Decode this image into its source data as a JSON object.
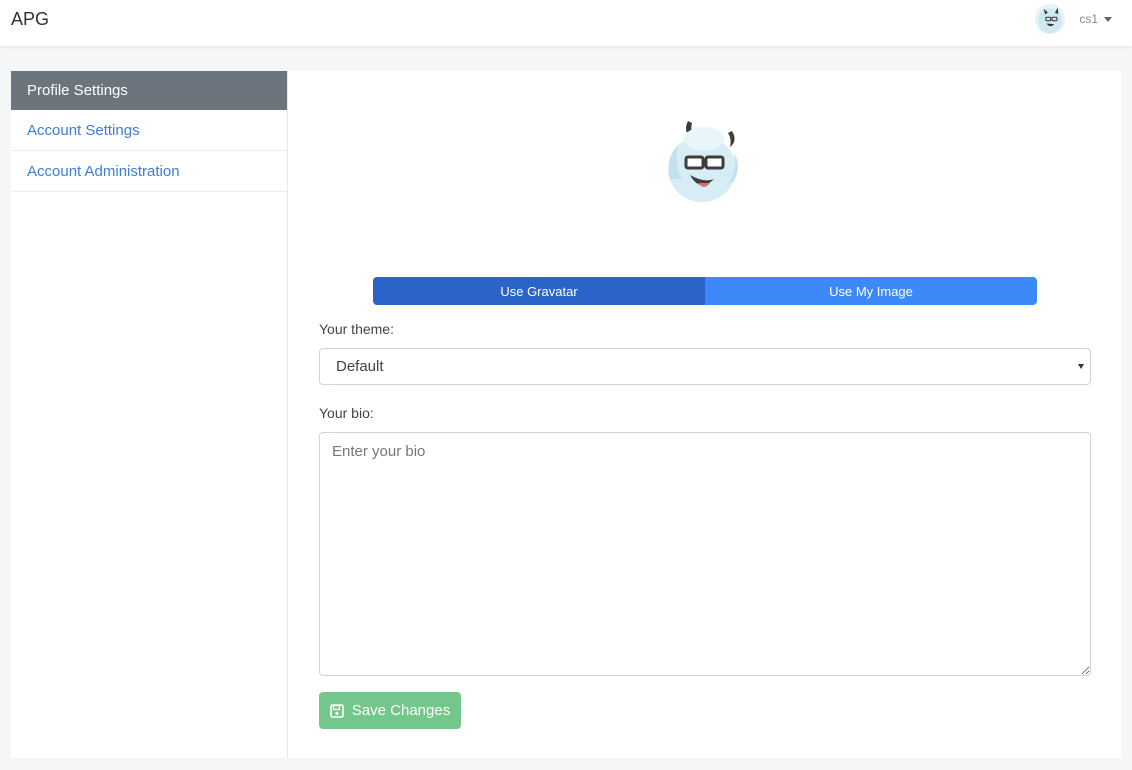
{
  "app": {
    "brand": "APG"
  },
  "user": {
    "name": "cs1",
    "avatar_icon": "yeti-avatar-icon"
  },
  "sidebar": {
    "items": [
      {
        "label": "Profile Settings",
        "active": true
      },
      {
        "label": "Account Settings",
        "active": false
      },
      {
        "label": "Account Administration",
        "active": false
      }
    ]
  },
  "profile": {
    "avatar_icon": "yeti-avatar-icon",
    "toggle": {
      "gravatar_label": "Use Gravatar",
      "my_image_label": "Use My Image",
      "selected": "gravatar"
    },
    "theme": {
      "label": "Your theme:",
      "value": "Default"
    },
    "bio": {
      "label": "Your bio:",
      "placeholder": "Enter your bio",
      "value": ""
    },
    "save": {
      "label": "Save Changes",
      "icon": "floppy-disk-icon"
    }
  },
  "colors": {
    "accent": "#2a64c9",
    "accent_light": "#3c89f7",
    "sidebar_active": "#6c757d",
    "link": "#3b7ddd",
    "save": "#74c78a"
  }
}
